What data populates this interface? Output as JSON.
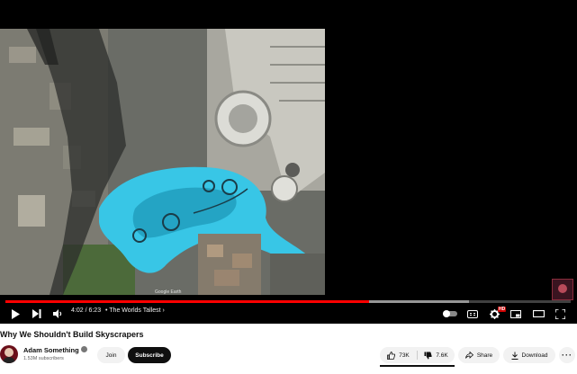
{
  "video": {
    "title": "Why We Shouldn't Build Skyscrapers",
    "time_display": "4:02 / 6:23",
    "chapter": "• The Worlds Tallest",
    "chapter_chevron": "›",
    "progress_fraction": 0.643,
    "loaded_fraction": 0.82,
    "watermark": "Google Earth"
  },
  "controls": {
    "icons": [
      "play-icon",
      "next-icon",
      "volume-icon",
      "autoplay-toggle",
      "captions-icon",
      "settings-icon",
      "miniplayer-icon",
      "theater-icon",
      "fullscreen-icon"
    ],
    "settings_badge": "HD"
  },
  "channel": {
    "name": "Adam Something",
    "subscribers": "1.53M subscribers",
    "join_label": "Join",
    "subscribe_label": "Subscribe"
  },
  "actions": {
    "likes": "73K",
    "dislikes": "7.6K",
    "share_label": "Share",
    "download_label": "Download",
    "more_label": "···"
  },
  "colors": {
    "accent": "#ff0000",
    "water": "#38c6e6",
    "subscribe_bg": "#0f0f0f",
    "pill_bg": "#f2f2f2"
  }
}
